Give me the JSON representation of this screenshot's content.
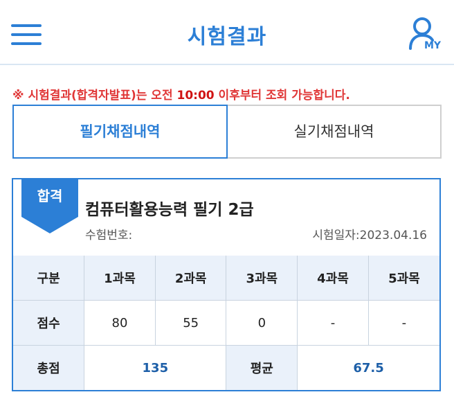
{
  "header": {
    "title": "시험결과",
    "my_label": "MY",
    "accent_color": "#2c7fd6"
  },
  "notice": {
    "prefix": "※ 시험결과(합격자발표)는 오전 ",
    "time": "10:00",
    "suffix": " 이후부터 조회 가능합니다."
  },
  "tabs": [
    {
      "label": "필기채점내역",
      "active": true
    },
    {
      "label": "실기채점내역",
      "active": false
    }
  ],
  "result": {
    "badge": "합격",
    "exam_name": "컴퓨터활용능력 필기 2급",
    "exam_no_label": "수험번호:",
    "exam_date": "시험일자:2023.04.16",
    "table": {
      "header": [
        "구분",
        "1과목",
        "2과목",
        "3과목",
        "4과목",
        "5과목"
      ],
      "score_row": [
        "점수",
        "80",
        "55",
        "0",
        "-",
        "-"
      ],
      "total_label": "총점",
      "total_value": "135",
      "avg_label": "평균",
      "avg_value": "67.5"
    }
  }
}
